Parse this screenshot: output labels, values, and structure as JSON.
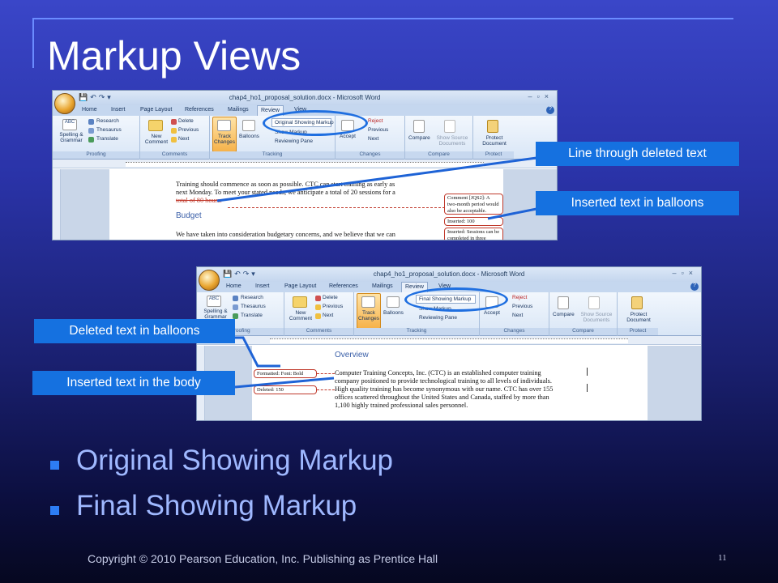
{
  "slide": {
    "title": "Markup Views",
    "bullets": [
      "Original Showing Markup",
      "Final Showing Markup"
    ],
    "footer": "Copyright © 2010 Pearson Education, Inc.  Publishing as Prentice Hall",
    "page_number": "11"
  },
  "callouts": {
    "line_through": "Line through deleted text",
    "inserted_balloons": "Inserted text in balloons",
    "deleted_balloons": "Deleted text in balloons",
    "inserted_body": "Inserted text in the body"
  },
  "colors": {
    "callout_bg": "#1571e0",
    "bullet_text": "#9fb8ff",
    "bullet_marker": "#2d7df5",
    "highlight": "#1f6fe0"
  },
  "word_top": {
    "title": "chap4_ho1_proposal_solution.docx - Microsoft Word",
    "tabs": [
      "Home",
      "Insert",
      "Page Layout",
      "References",
      "Mailings",
      "Review",
      "View"
    ],
    "active_tab": "Review",
    "ribbon": {
      "spelling": "Spelling & Grammar",
      "research": "Research",
      "thesaurus": "Thesaurus",
      "translate": "Translate",
      "new_comment": "New Comment",
      "delete": "Delete",
      "previous": "Previous",
      "next": "Next",
      "track_changes": "Track Changes",
      "balloons": "Balloons",
      "display_mode": "Original Showing Markup",
      "show_markup": "Show Markup",
      "reviewing_pane": "Reviewing Pane",
      "accept": "Accept",
      "reject": "Reject",
      "compare": "Compare",
      "show_source": "Show Source Documents",
      "protect": "Protect Document",
      "groups": [
        "Proofing",
        "Comments",
        "Tracking",
        "Changes",
        "Compare",
        "Protect"
      ]
    },
    "doc": {
      "line1": "Training should commence as soon as possible. CTC can start training as early as",
      "line2": "next Monday. To meet your stated needs, we anticipate a total of 20 sessions for a",
      "line3": "total of 80 hours.",
      "heading": "Budget",
      "line4": "We have taken into consideration budgetary concerns, and we believe that we can",
      "balloon1": "Comment [JQS2]: A two-month period would also be acceptable.",
      "balloon2": "Inserted: 100",
      "balloon3": "Inserted: Sessions can be completed in three"
    }
  },
  "word_bottom": {
    "title": "chap4_ho1_proposal_solution.docx - Microsoft Word",
    "tabs": [
      "Home",
      "Insert",
      "Page Layout",
      "References",
      "Mailings",
      "Review",
      "View"
    ],
    "active_tab": "Review",
    "ribbon": {
      "spelling": "Spelling & Grammar",
      "research": "Research",
      "thesaurus": "Thesaurus",
      "translate": "Translate",
      "new_comment": "New Comment",
      "delete": "Delete",
      "previous": "Previous",
      "next": "Next",
      "track_changes": "Track Changes",
      "balloons": "Balloons",
      "display_mode": "Final Showing Markup",
      "show_markup": "Show Markup",
      "reviewing_pane": "Reviewing Pane",
      "accept": "Accept",
      "reject": "Reject",
      "compare": "Compare",
      "show_source": "Show Source Documents",
      "protect": "Protect Document",
      "groups": [
        "Proofing",
        "Comments",
        "Tracking",
        "Changes",
        "Compare",
        "Protect"
      ]
    },
    "doc": {
      "heading": "Overview",
      "line1": "Computer Training Concepts, Inc. (CTC) is an established computer training",
      "line2": "company positioned to provide technological training to all levels of individuals.",
      "line3": "High quality training has become synonymous with our name. CTC has over 155",
      "line4": "offices scattered throughout the United States and Canada, staffed by more than",
      "line5": "1,100 highly trained professional sales personnel.",
      "balloon1": "Formatted: Font: Bold",
      "balloon2": "Deleted: 150"
    }
  }
}
